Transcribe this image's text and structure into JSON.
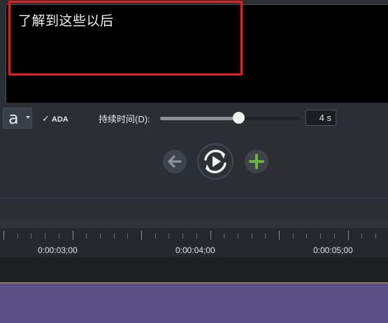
{
  "caption": {
    "text": "了解到这些以后"
  },
  "toolbar": {
    "font_glyph": "a",
    "ada_check": "✓",
    "ada_label": "ADA",
    "duration_label": "持续时间(D):",
    "duration_value": "4 s",
    "duration_slider_fraction": 0.56
  },
  "controls": {
    "back_icon": "back-arrow-icon",
    "replay_icon": "replay-icon",
    "add_icon": "plus-icon",
    "add_color": "#6db33f"
  },
  "timeline": {
    "timecodes": [
      "0:00:03;00",
      "0:00:04;00",
      "0:00:05;00"
    ],
    "track_color": "#5a4f85",
    "highlight_color": "#e02020"
  }
}
